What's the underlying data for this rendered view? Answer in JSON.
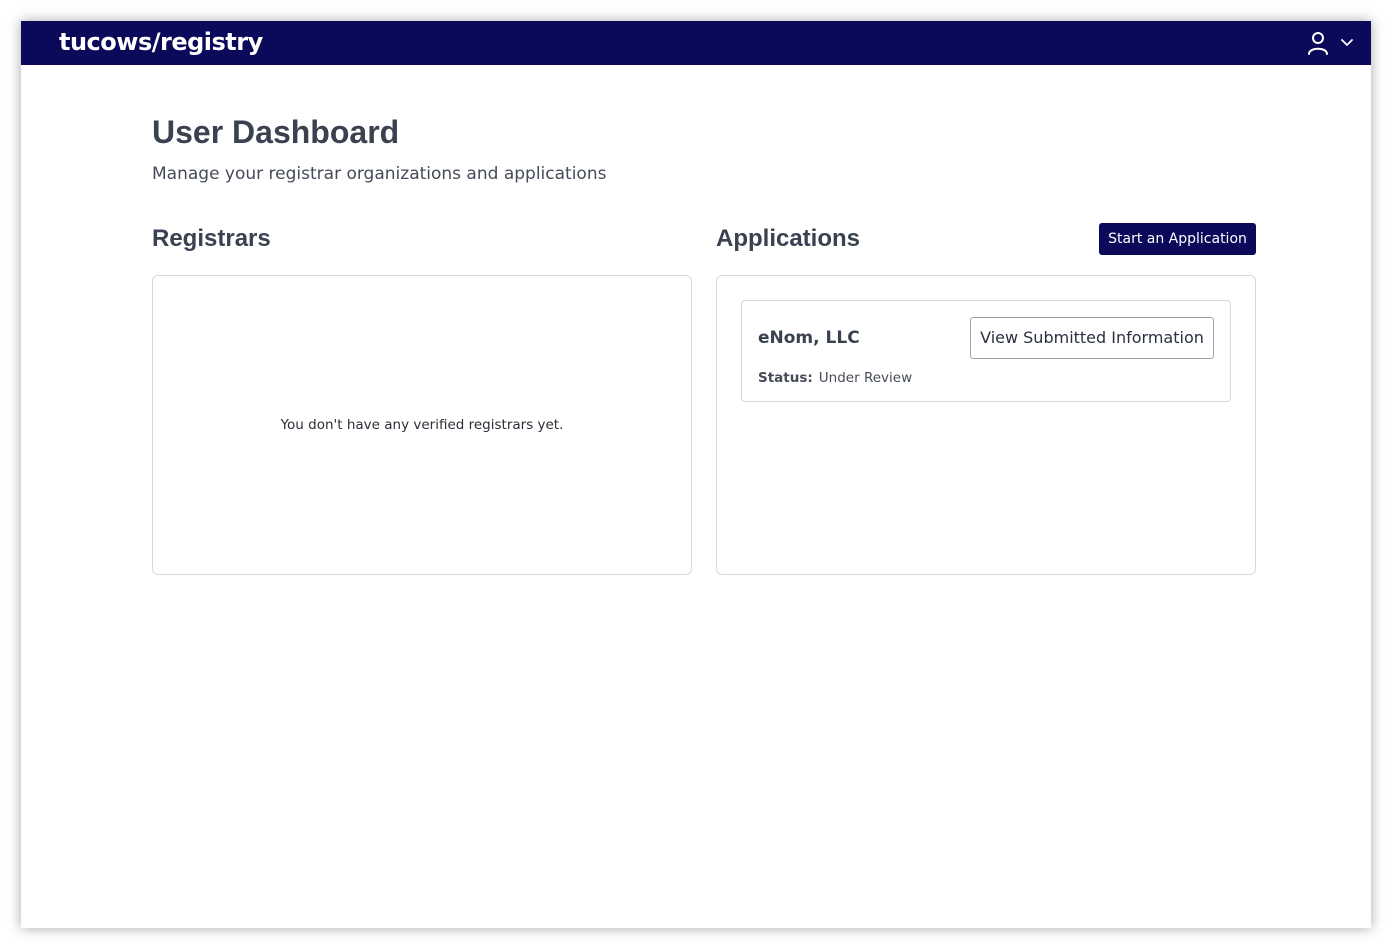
{
  "header": {
    "logo_text": "tucows/registry",
    "user_icon": "user-icon",
    "menu_icon": "chevron-down-icon",
    "background_color": "#0b0959"
  },
  "page": {
    "title": "User Dashboard",
    "subtitle": "Manage your registrar organizations and applications"
  },
  "registrars": {
    "title": "Registrars",
    "empty_message": "You don't have any verified registrars yet."
  },
  "applications": {
    "title": "Applications",
    "start_button_label": "Start an Application",
    "items": [
      {
        "name": "eNom, LLC",
        "view_button_label": "View Submitted Information",
        "status_label": "Status:",
        "status_value": "Under Review"
      }
    ]
  }
}
